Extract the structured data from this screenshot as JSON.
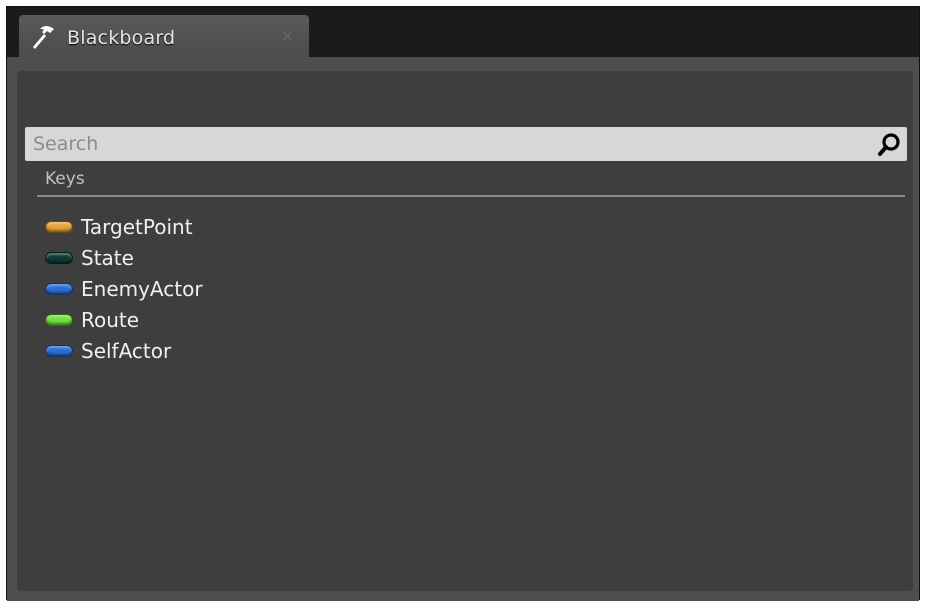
{
  "window": {
    "tab_title": "Blackboard",
    "tab_icon": "hammer-icon",
    "close_glyph": "×"
  },
  "search": {
    "placeholder": "Search",
    "value": "",
    "icon": "search-icon"
  },
  "keys": {
    "header": "Keys",
    "items": [
      {
        "label": "TargetPoint",
        "color": "#e8a23a"
      },
      {
        "label": "State",
        "color": "#0f3b38"
      },
      {
        "label": "EnemyActor",
        "color": "#2a6fd6"
      },
      {
        "label": "Route",
        "color": "#6fe23a"
      },
      {
        "label": "SelfActor",
        "color": "#2a6fd6"
      }
    ]
  }
}
